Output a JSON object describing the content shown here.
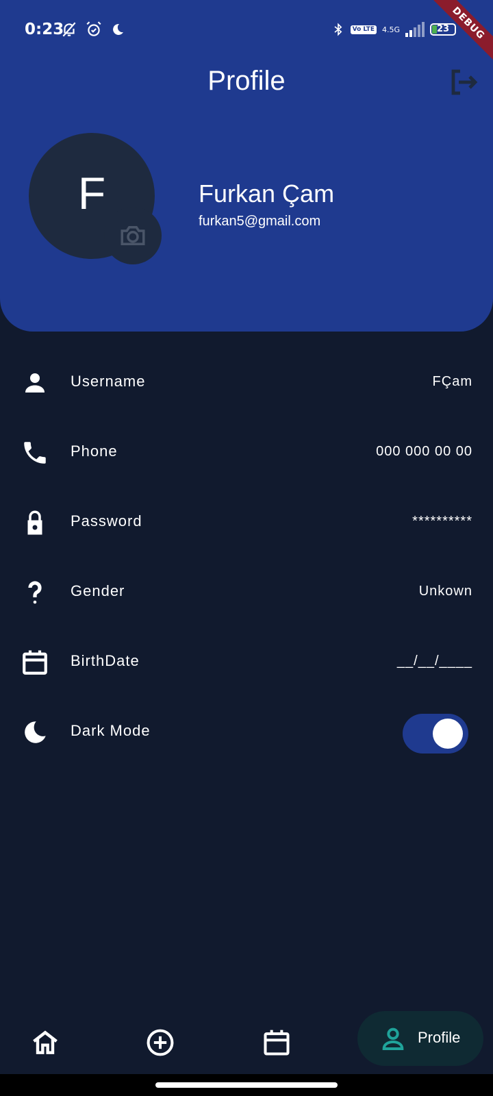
{
  "status_bar": {
    "time": "0:23",
    "volte": "Vo LTE",
    "network": "4.5G",
    "battery": "23",
    "icons": [
      "muted-bell-icon",
      "alarm-icon",
      "moon-icon",
      "bluetooth-icon",
      "signal-icon",
      "battery-icon"
    ]
  },
  "debug_banner": "DEBUG",
  "header": {
    "title": "Profile",
    "logout_icon": "logout-icon"
  },
  "profile": {
    "initial": "F",
    "name": "Furkan Çam",
    "email": "furkan5@gmail.com",
    "camera_icon": "camera-icon"
  },
  "settings": [
    {
      "label": "Username",
      "value": "FÇam",
      "icon": "person-icon"
    },
    {
      "label": "Phone",
      "value": "000 000 00 00",
      "icon": "phone-icon"
    },
    {
      "label": "Password",
      "value": "**********",
      "icon": "lock-icon"
    },
    {
      "label": "Gender",
      "value": "Unkown",
      "icon": "question-icon"
    },
    {
      "label": "BirthDate",
      "value": "__/__/____",
      "icon": "calendar-icon"
    },
    {
      "label": "Dark Mode",
      "toggle_on": true,
      "icon": "moon-icon"
    }
  ],
  "bottom_nav": {
    "items": [
      "home-icon",
      "add-circle-icon",
      "calendar-icon",
      "person-icon"
    ],
    "active_label": "Profile"
  },
  "colors": {
    "header": "#1f3a8f",
    "background": "#111a2e",
    "avatar": "#1e2a3f",
    "accent": "#1fa39a",
    "debug": "#8b1c2c"
  }
}
